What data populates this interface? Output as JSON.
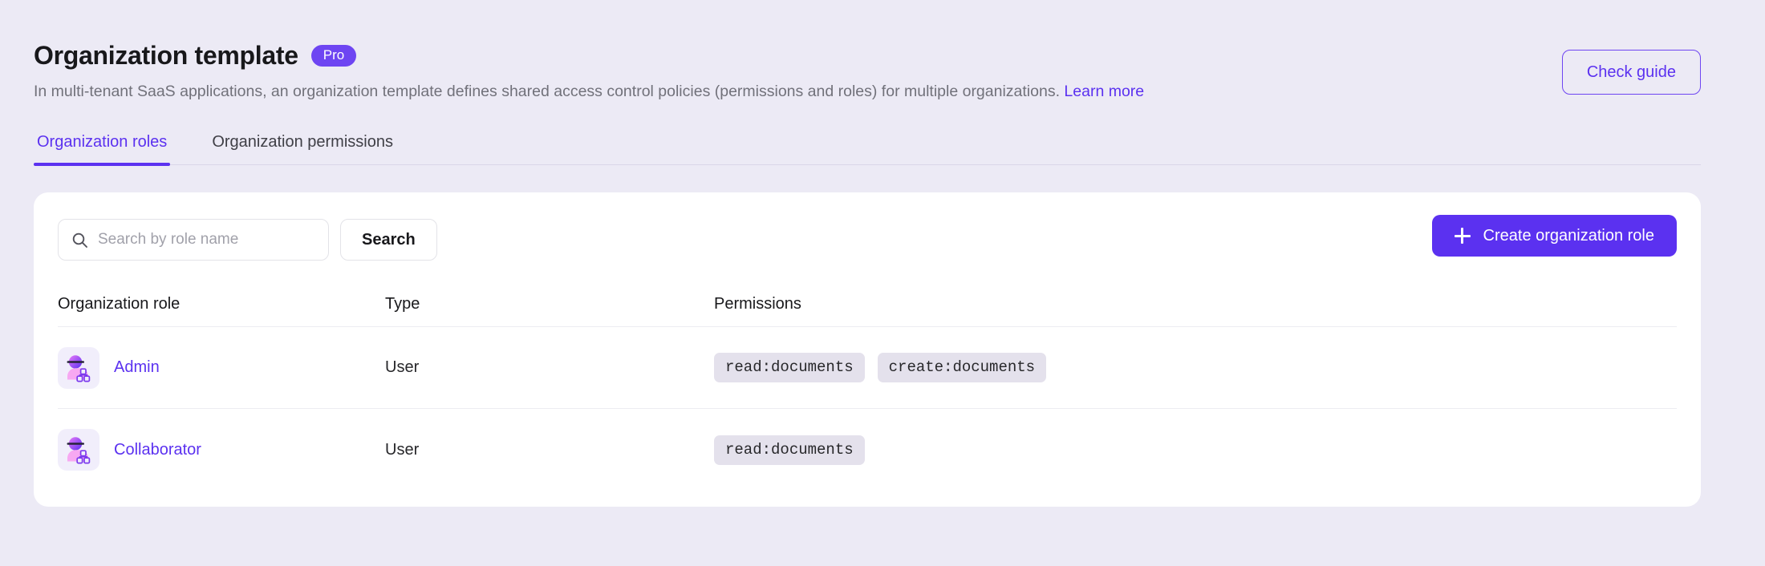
{
  "header": {
    "title": "Organization template",
    "badge": "Pro",
    "description_before": "In multi-tenant SaaS applications, an organization template defines shared access control policies (permissions and roles) for multiple organizations. ",
    "learn_more": "Learn more",
    "check_guide_label": "Check guide"
  },
  "tabs": [
    {
      "label": "Organization roles",
      "active": true
    },
    {
      "label": "Organization permissions",
      "active": false
    }
  ],
  "toolbar": {
    "search_placeholder": "Search by role name",
    "search_value": "",
    "search_button_label": "Search",
    "create_button_label": "Create organization role",
    "search_icon": "search-icon",
    "plus_icon": "plus-icon"
  },
  "table": {
    "columns": [
      "Organization role",
      "Type",
      "Permissions"
    ],
    "rows": [
      {
        "role": "Admin",
        "type": "User",
        "permissions": [
          "read:documents",
          "create:documents"
        ],
        "avatar_icon": "organization-role-avatar-icon"
      },
      {
        "role": "Collaborator",
        "type": "User",
        "permissions": [
          "read:documents"
        ],
        "avatar_icon": "organization-role-avatar-icon"
      }
    ]
  },
  "colors": {
    "page_background": "#ECEAF5",
    "accent": "#5B31F0",
    "badge_purple": "#6E45F2",
    "card_background": "#FFFFFF",
    "chip_background": "#E4E1EC",
    "muted_text": "#71717A"
  }
}
